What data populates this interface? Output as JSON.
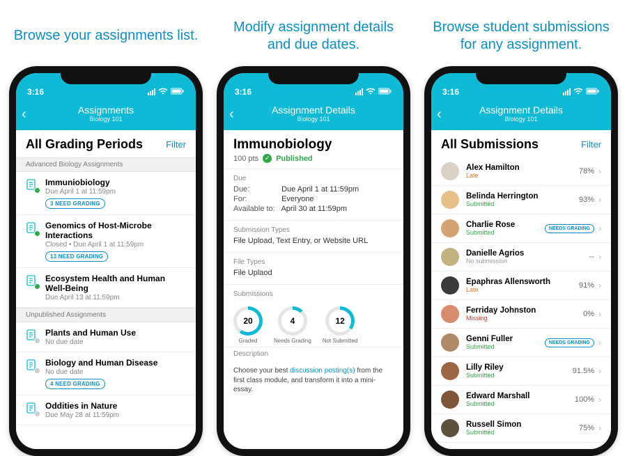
{
  "captions": {
    "c1": "Browse your assignments list.",
    "c2": "Modify assignment details and due dates.",
    "c3": "Browse student submissions for any assignment."
  },
  "statusbar": {
    "time": "3:16"
  },
  "nav": {
    "s1": {
      "title": "Assignments",
      "subtitle": "Biology 101"
    },
    "s2": {
      "title": "Assignment Details",
      "subtitle": "Biology 101"
    },
    "s3": {
      "title": "Assignment Details",
      "subtitle": "Biology 101"
    }
  },
  "filter_label": "Filter",
  "s1": {
    "heading": "All Grading Periods",
    "sections": {
      "a": "Advanced Biology Assignments",
      "b": "Unpublished Assignments"
    },
    "items": [
      {
        "title": "Immuniobiology",
        "sub": "Due April 1 at 11:59pm",
        "badge": "3 NEED GRADING",
        "pub": true
      },
      {
        "title": "Genomics of Host-Microbe Interactions",
        "sub": "Closed  •  Due April 1 at 11:59pm",
        "badge": "13 NEED GRADING",
        "pub": true
      },
      {
        "title": "Ecosystem Health and Human Well-Being",
        "sub": "Due April 13 at 11:59pm",
        "badge": "",
        "pub": true
      },
      {
        "title": "Plants and Human Use",
        "sub": "No due date",
        "badge": "",
        "pub": false
      },
      {
        "title": "Biology and Human Disease",
        "sub": "No due date",
        "badge": "4 NEED GRADING",
        "pub": false
      },
      {
        "title": "Oddities in Nature",
        "sub": "Due May 28 at 11:59pm",
        "badge": "",
        "pub": false
      }
    ]
  },
  "s2": {
    "title": "Immunobiology",
    "points": "100 pts",
    "published": "Published",
    "due_h": "Due",
    "due": "Due April 1 at 11:59pm",
    "for": "Everyone",
    "avail": "April 30 at 11:59pm",
    "due_lbl": "Due:",
    "for_lbl": "For:",
    "avail_lbl": "Available to:",
    "subtypes_h": "Submission Types",
    "subtypes": "File Upload, Text Entry, or Website URL",
    "filetypes_h": "File Types",
    "filetypes": "File Uplaod",
    "subs_h": "Submissions",
    "donuts": [
      {
        "n": "20",
        "label": "Graded",
        "pct": 60
      },
      {
        "n": "4",
        "label": "Needs Grading",
        "pct": 12
      },
      {
        "n": "12",
        "label": "Not Submitted",
        "pct": 35
      }
    ],
    "desc_h": "Description",
    "desc_a": "Choose your best ",
    "desc_link": "discussion posting(s)",
    "desc_b": " from the first class module, and transform it into a mini-essay."
  },
  "s3": {
    "heading": "All Submissions",
    "needs_grading": "NEEDS GRADING",
    "students": [
      {
        "name": "Alex Hamilton",
        "status": "Late",
        "cls": "st-late",
        "grade": "78%"
      },
      {
        "name": "Belinda Herrington",
        "status": "Submitted",
        "cls": "st-sub",
        "grade": "93%"
      },
      {
        "name": "Charlie Rose",
        "status": "Submitted",
        "cls": "st-sub",
        "grade": "",
        "badge": true
      },
      {
        "name": "Danielle Agrios",
        "status": "No submission",
        "cls": "st-none",
        "grade": "--"
      },
      {
        "name": "Epaphras Allensworth",
        "status": "Late",
        "cls": "st-late",
        "grade": "91%"
      },
      {
        "name": "Ferriday Johnston",
        "status": "Missing",
        "cls": "st-miss",
        "grade": "0%"
      },
      {
        "name": "Genni Fuller",
        "status": "Submitted",
        "cls": "st-sub",
        "grade": "",
        "badge": true
      },
      {
        "name": "Lilly Riley",
        "status": "Submitted",
        "cls": "st-sub",
        "grade": "91.5%"
      },
      {
        "name": "Edward Marshall",
        "status": "Submitted",
        "cls": "st-sub",
        "grade": "100%"
      },
      {
        "name": "Russell Simon",
        "status": "Submitted",
        "cls": "st-sub",
        "grade": "75%"
      }
    ]
  }
}
